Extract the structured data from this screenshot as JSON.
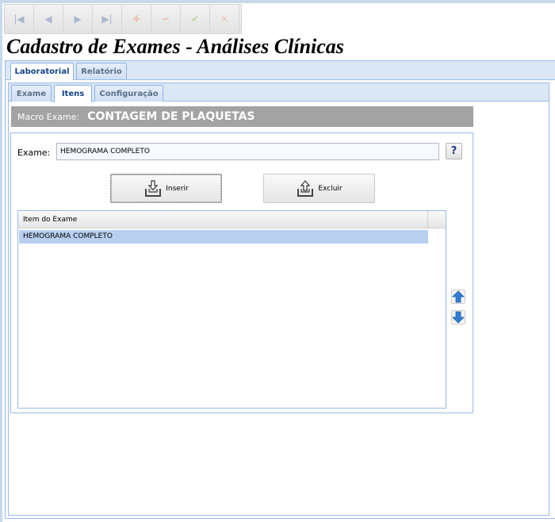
{
  "toolbar": {
    "buttons": [
      {
        "name": "first-record-button",
        "glyph": "|◀"
      },
      {
        "name": "previous-record-button",
        "glyph": "◀"
      },
      {
        "name": "next-record-button",
        "glyph": "▶"
      },
      {
        "name": "last-record-button",
        "glyph": "▶|"
      },
      {
        "name": "add-button",
        "glyph": "✚"
      },
      {
        "name": "remove-button",
        "glyph": "━"
      },
      {
        "name": "confirm-button",
        "glyph": "✔"
      },
      {
        "name": "cancel-button",
        "glyph": "✕"
      }
    ]
  },
  "page": {
    "title": "Cadastro de Exames - Análises Clínicas"
  },
  "main_tabs": {
    "laboratorial": "Laboratorial",
    "relatorio": "Relatório",
    "active": "Laboratorial"
  },
  "sub_tabs": {
    "exame": "Exame",
    "itens": "Itens",
    "configuracao": "Configuração",
    "active": "Itens"
  },
  "macro": {
    "label": "Macro Exame:",
    "value": "CONTAGEM DE PLAQUETAS"
  },
  "exame_field": {
    "label": "Exame:",
    "value": "HEMOGRAMA COMPLETO",
    "help_glyph": "?"
  },
  "actions": {
    "insert_label": "Inserir",
    "delete_label": "Excluir"
  },
  "grid": {
    "columns": [
      "Item do Exame"
    ],
    "rows": [
      {
        "item": "HEMOGRAMA COMPLETO",
        "selected": true
      }
    ]
  },
  "icons": {
    "move_up": "arrow-up-icon",
    "move_down": "arrow-down-icon",
    "insert": "insert-tray-icon",
    "delete": "delete-tray-icon"
  },
  "colors": {
    "panel_border": "#99bbe8",
    "tab_strip": "#dbe7f5",
    "macro_bar": "#a3a3a3",
    "selected_row": "#b8cff0",
    "arrow_blue": "#2f7fd6"
  }
}
